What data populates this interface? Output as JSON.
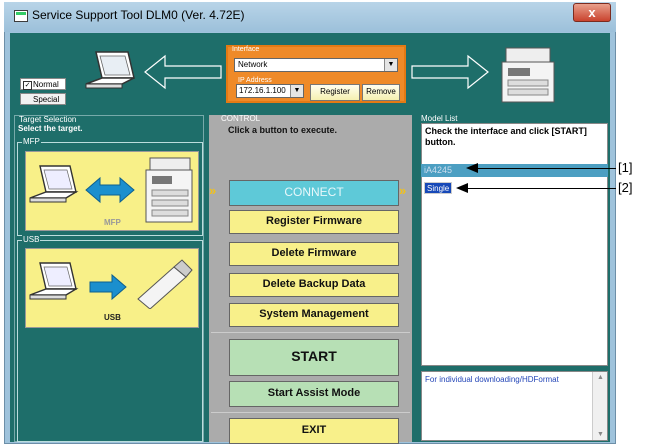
{
  "window": {
    "title": "Service Support Tool DLM0 (Ver. 4.72E)",
    "close": "x"
  },
  "mode": {
    "normal": "Normal",
    "special": "Special"
  },
  "interface": {
    "legend": "Interface",
    "selected": "Network",
    "ip_legend": "IP Address",
    "ip_value": "172.16.1.100",
    "register": "Register",
    "remove": "Remove"
  },
  "target": {
    "legend": "Target Selection",
    "prompt": "Select the target.",
    "mfp_legend": "MFP",
    "mfp_label": "MFP",
    "usb_legend": "USB",
    "usb_label": "USB"
  },
  "control": {
    "legend": "CONTROL",
    "prompt": "Click a button to execute.",
    "connect": "CONNECT",
    "register_firmware": "Register Firmware",
    "delete_firmware": "Delete Firmware",
    "delete_backup": "Delete Backup Data",
    "system_management": "System Management",
    "start": "START",
    "start_assist": "Start Assist Mode",
    "exit": "EXIT"
  },
  "model_list": {
    "legend": "Model List",
    "prompt": "Check the interface and click [START] button.",
    "selected_model": "iA4245",
    "type": "Single",
    "description": "For individual downloading/HDFormat"
  },
  "callouts": {
    "c1": "[1]",
    "c2": "[2]"
  },
  "colors": {
    "accent_orange": "#ef8a28",
    "panel_teal": "#1e6e6a",
    "button_yellow": "#f8f08a",
    "button_green": "#b7e0b5",
    "connect_cyan": "#5ec9d8",
    "selection_blue": "#1749b8"
  }
}
